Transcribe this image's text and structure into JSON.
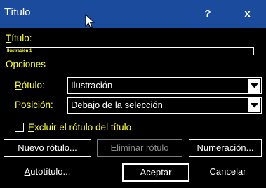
{
  "window": {
    "title": "Título",
    "help_label": "?",
    "close_label": "x"
  },
  "titulo_field": {
    "label_accel": "T",
    "label_rest": "ítulo:",
    "value": "Ilustración 1"
  },
  "options": {
    "group_label": "Opciones",
    "rotulo_accel": "R",
    "rotulo_rest": "ótulo:",
    "rotulo_value": "Ilustración",
    "posicion_accel": "P",
    "posicion_rest": "osición:",
    "posicion_value": "Debajo de la selección"
  },
  "exclude_checkbox": {
    "accel": "E",
    "rest": "xcluir el rótulo del título",
    "checked": false
  },
  "buttons": {
    "nuevo_pre": "Nuevo rót",
    "nuevo_accel": "u",
    "nuevo_post": "lo...",
    "eliminar": "Eliminar rótulo",
    "numeracion_accel": "N",
    "numeracion_rest": "umeración...",
    "autotitulo_accel": "A",
    "autotitulo_rest": "utotítulo...",
    "aceptar": "Aceptar",
    "cancelar": "Cancelar"
  }
}
